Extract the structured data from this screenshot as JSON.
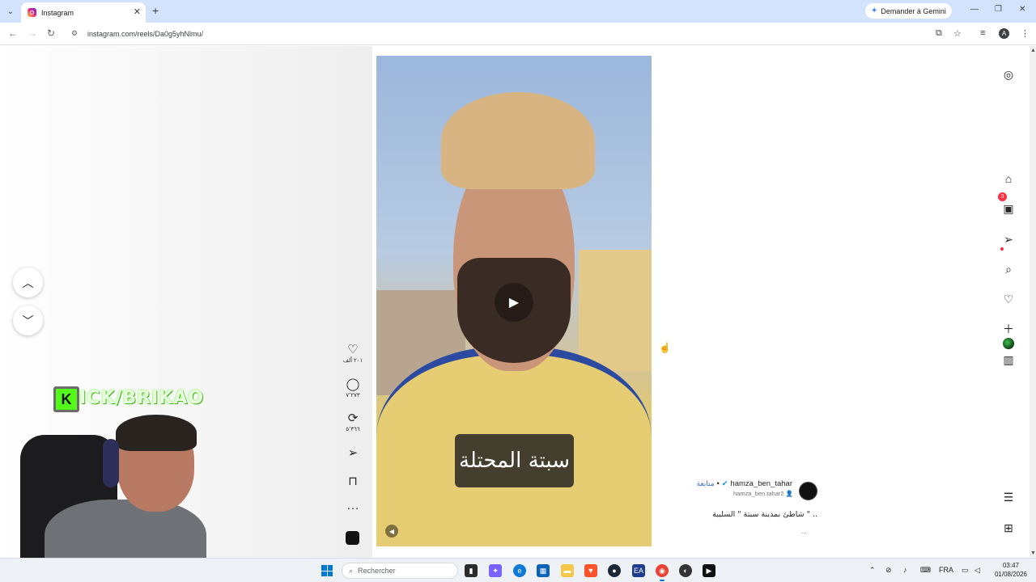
{
  "browser": {
    "tab": {
      "title": "Instagram",
      "close": "✕"
    },
    "new_tab": "+",
    "gemini_button": "Demander à Gemini",
    "window": {
      "minimize": "—",
      "restore": "❐",
      "close": "✕"
    },
    "nav": {
      "back": "←",
      "forward": "→",
      "reload": "↻"
    },
    "url": "instagram.com/reels/Da0g5yhNlmu/",
    "profile_initial": "A"
  },
  "reel": {
    "caption_overlay": "سبتة المحتلة",
    "play_icon": "▶",
    "mute_icon": "🔈",
    "actions": {
      "likes": "٢٠١ ألف",
      "comments": "٧٬٢٧٣",
      "reposts": "٥٬٣٦٦"
    },
    "author": {
      "name": "hamza_ben_tahar",
      "follow": "متابعة",
      "handle": "hamza_ben.tahar2",
      "caption": "شاطئ بمدينة سبتة \" السليبة \" ..",
      "more": "..."
    }
  },
  "sidenav": {
    "notification_badge": "3"
  },
  "overlay": {
    "kick_logo_letter": "K",
    "kick_text": "ICK/BRIKAO"
  },
  "taskbar": {
    "search_placeholder": "Rechercher",
    "language": "FRA",
    "time": "03:47",
    "date": "01/08/2026"
  },
  "colors": {
    "instagram_accent": "#ff3040",
    "verified": "#0095f6",
    "kick_green": "#53fc18",
    "tabstrip": "#d3e3fd"
  }
}
